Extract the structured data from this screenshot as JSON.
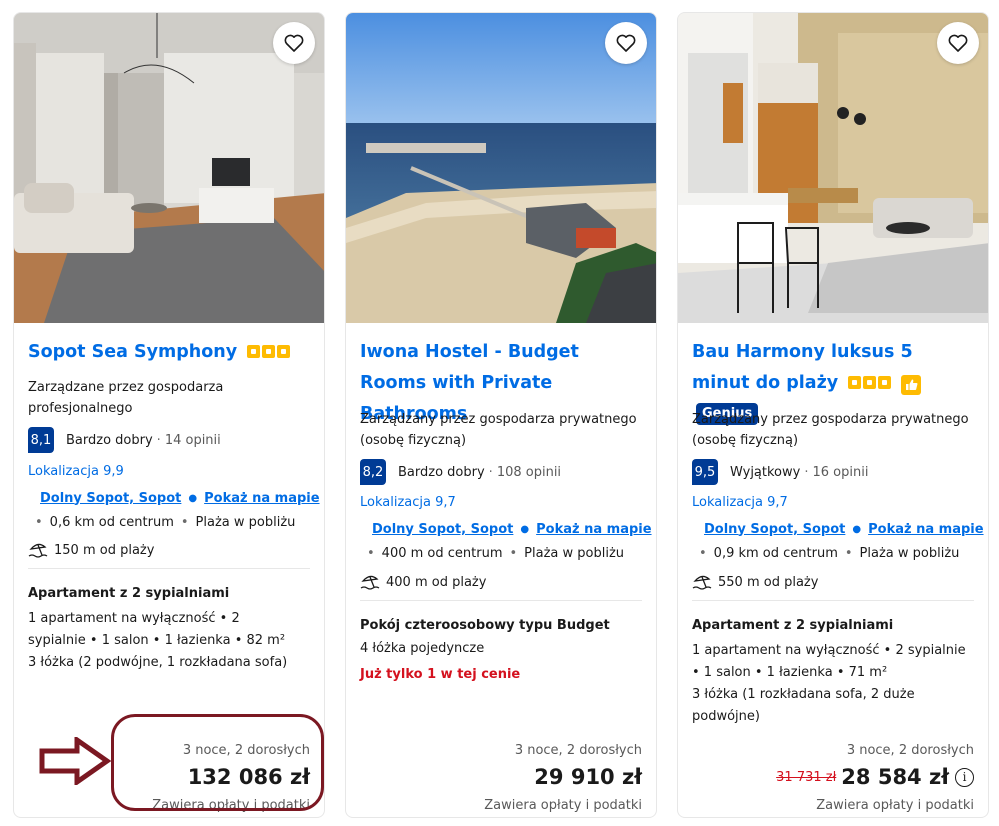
{
  "cards": [
    {
      "title": "Sopot Sea Symphony",
      "managed": "Zarządzane przez gospodarza profesjonalnego",
      "score": "8,1",
      "score_word": "Bardzo dobry",
      "reviews": "14 opinii",
      "location_score": "Lokalizacja 9,9",
      "district": "Dolny Sopot, Sopot",
      "map_link": "Pokaż na mapie",
      "distance": "0,6 km od centrum",
      "beach_near": "Plaża w pobliżu",
      "beach_distance": "150 m od plaży",
      "room_title": "Apartament z 2 sypialniami",
      "room_details": "1 apartament na wyłączność • 2 sypialnie • 1 salon • 1 łazienka • 82 m²",
      "beds": "3 łóżka (2 podwójne, 1 rozkładana sofa)",
      "stay": "3 noce, 2 dorosłych",
      "price": "132 086 zł",
      "taxes": "Zawiera opłaty i podatki",
      "star_count": 3
    },
    {
      "title": "Iwona Hostel - Budget Rooms with Private Bathrooms",
      "managed": "Zarządzany przez gospodarza prywatnego (osobę fizyczną)",
      "score": "8,2",
      "score_word": "Bardzo dobry",
      "reviews": "108 opinii",
      "location_score": "Lokalizacja 9,7",
      "district": "Dolny Sopot, Sopot",
      "map_link": "Pokaż na mapie",
      "distance": "400 m od centrum",
      "beach_near": "Plaża w pobliżu",
      "beach_distance": "400 m od plaży",
      "room_title": "Pokój czteroosobowy typu Budget",
      "beds": "4 łóżka pojedyncze",
      "urgency": "Już tylko 1 w tej cenie",
      "stay": "3 noce, 2 dorosłych",
      "price": "29 910 zł",
      "taxes": "Zawiera opłaty i podatki"
    },
    {
      "title": "Bau Harmony luksus 5 minut do plaży",
      "genius": "Genius",
      "managed": "Zarządzany przez gospodarza prywatnego (osobę fizyczną)",
      "score": "9,5",
      "score_word": "Wyjątkowy",
      "reviews": "16 opinii",
      "location_score": "Lokalizacja 9,7",
      "district": "Dolny Sopot, Sopot",
      "map_link": "Pokaż na mapie",
      "distance": "0,9 km od centrum",
      "beach_near": "Plaża w pobliżu",
      "beach_distance": "550 m od plaży",
      "room_title": "Apartament z 2 sypialniami",
      "room_details": "1 apartament na wyłączność • 2 sypialnie • 1 salon • 1 łazienka • 71 m²",
      "beds": "3 łóżka (1 rozkładana sofa, 2 duże podwójne)",
      "stay": "3 noce, 2 dorosłych",
      "old_price": "31 731 zł",
      "price": "28 584 zł",
      "taxes": "Zawiera opłaty i podatki",
      "star_count": 3
    }
  ],
  "colors": {
    "link": "#006ce4",
    "score_bg": "#003b95",
    "star": "#febb02",
    "urgent": "#d4111e",
    "annotation": "#7b1822"
  }
}
